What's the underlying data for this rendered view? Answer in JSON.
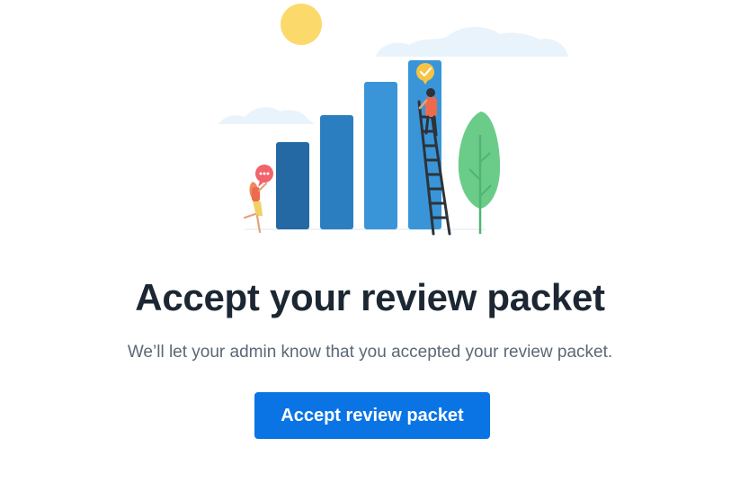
{
  "page": {
    "title": "Accept your review packet",
    "subtitle": "We’ll let your admin know that you accepted your review packet."
  },
  "actions": {
    "accept_label": "Accept review packet"
  },
  "colors": {
    "accent": "#0b74e5",
    "title": "#1c2733",
    "subtitle": "#5a6876",
    "sun": "#fcd96b",
    "cloud": "#e9f3fb",
    "bar_dark": "#2469a3",
    "bar_mid": "#2b7fc0",
    "bar_light": "#3a95d8",
    "tree": "#6bcc8a",
    "ladder": "#2d3339",
    "person_shirt": "#ee6a4e",
    "person_pants": "#f2d063",
    "speech_bubble": "#f3636b"
  },
  "illustration": {
    "icons": [
      "sun-icon",
      "cloud-icon",
      "bar-chart-icon",
      "ladder-icon",
      "person-icon",
      "tree-icon",
      "speech-bubble-icon",
      "checkmark-badge-icon"
    ]
  }
}
